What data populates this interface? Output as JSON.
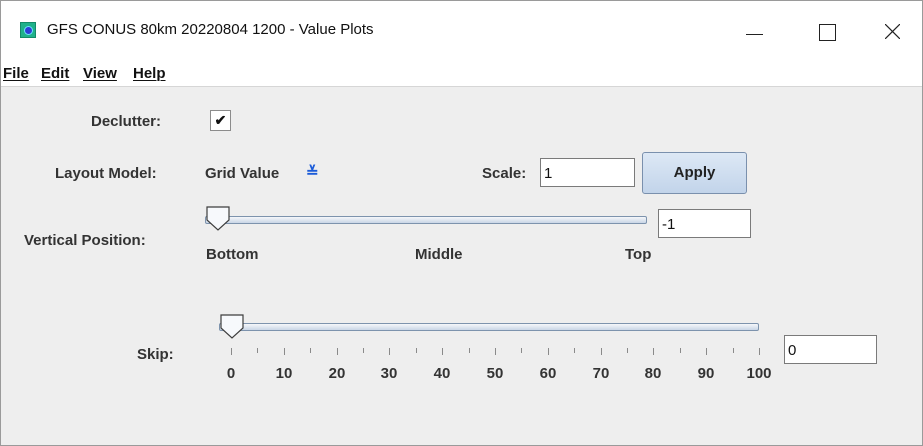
{
  "window": {
    "title": "GFS CONUS 80km 20220804 1200 - Value Plots",
    "accent_color": "#1fb18a"
  },
  "menu": [
    "File",
    "Edit",
    "View",
    "Help"
  ],
  "declutter": {
    "label": "Declutter:",
    "checked": true,
    "mark": "✔"
  },
  "layout_model": {
    "label": "Layout Model:",
    "value": "Grid Value",
    "chevron": "≚"
  },
  "scale": {
    "label": "Scale:",
    "value": "1"
  },
  "apply_button": {
    "label": "Apply"
  },
  "vertical_position": {
    "label": "Vertical Position:",
    "value": "-1",
    "level": 0,
    "tick_labels": [
      "Bottom",
      "Middle",
      "Top"
    ]
  },
  "skip": {
    "label": "Skip:",
    "value": "0",
    "level": 0,
    "min": 0,
    "max": 100,
    "tick_labels": [
      "0",
      "10",
      "20",
      "30",
      "40",
      "50",
      "60",
      "70",
      "80",
      "90",
      "100"
    ]
  }
}
